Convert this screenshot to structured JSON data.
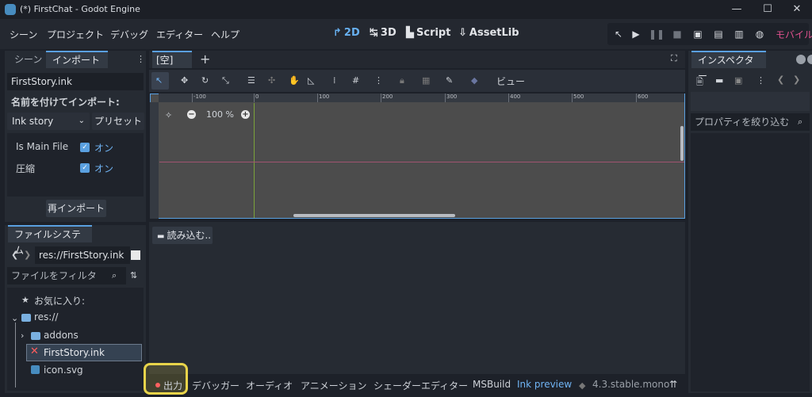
{
  "window": {
    "title": "(*) FirstChat - Godot Engine",
    "minimize": "—",
    "maximize": "☐",
    "close": "✕"
  },
  "menu": {
    "items": [
      "シーン",
      "プロジェクト",
      "デバッグ",
      "エディター",
      "ヘルプ"
    ]
  },
  "workspaces": [
    {
      "label": "2D",
      "icon": "↱"
    },
    {
      "label": "3D",
      "icon": "↹"
    },
    {
      "label": "Script",
      "icon": "▙"
    },
    {
      "label": "AssetLib",
      "icon": "⇩"
    }
  ],
  "renderer": "モバイル",
  "scene_dock": {
    "tabs": [
      "シーン",
      "インポート"
    ],
    "file": "FirstStory.ink",
    "import_as_label": "名前を付けてインポート:",
    "import_type": "Ink story",
    "preset_label": "プリセット",
    "options": [
      {
        "name": "Is Main File",
        "value": "オン"
      },
      {
        "name": "圧縮",
        "value": "オン"
      }
    ],
    "reimport_label": "再インポート"
  },
  "filesystem": {
    "tab": "ファイルシステム",
    "path": "res://FirstStory.ink",
    "filter_placeholder": "ファイルをフィルタ",
    "favorites": "お気に入り:",
    "root": "res://",
    "items": [
      "addons",
      "FirstStory.ink",
      "icon.svg"
    ]
  },
  "editor": {
    "scene_tab": "[空]",
    "toolbar_view": "ビュー",
    "zoom": "100 %",
    "ruler_labels": [
      "-100",
      "0",
      "100",
      "200",
      "300",
      "400",
      "500",
      "600"
    ],
    "load_label": "読み込む.."
  },
  "inspector": {
    "tab": "インスペクター",
    "filter_placeholder": "プロパティを絞り込む"
  },
  "bottom": {
    "tabs": [
      "出力",
      "デバッガー",
      "オーディオ",
      "アニメーション",
      "シェーダーエディター",
      "MSBuild",
      "Ink preview"
    ],
    "version": "4.3.stable.mono"
  }
}
